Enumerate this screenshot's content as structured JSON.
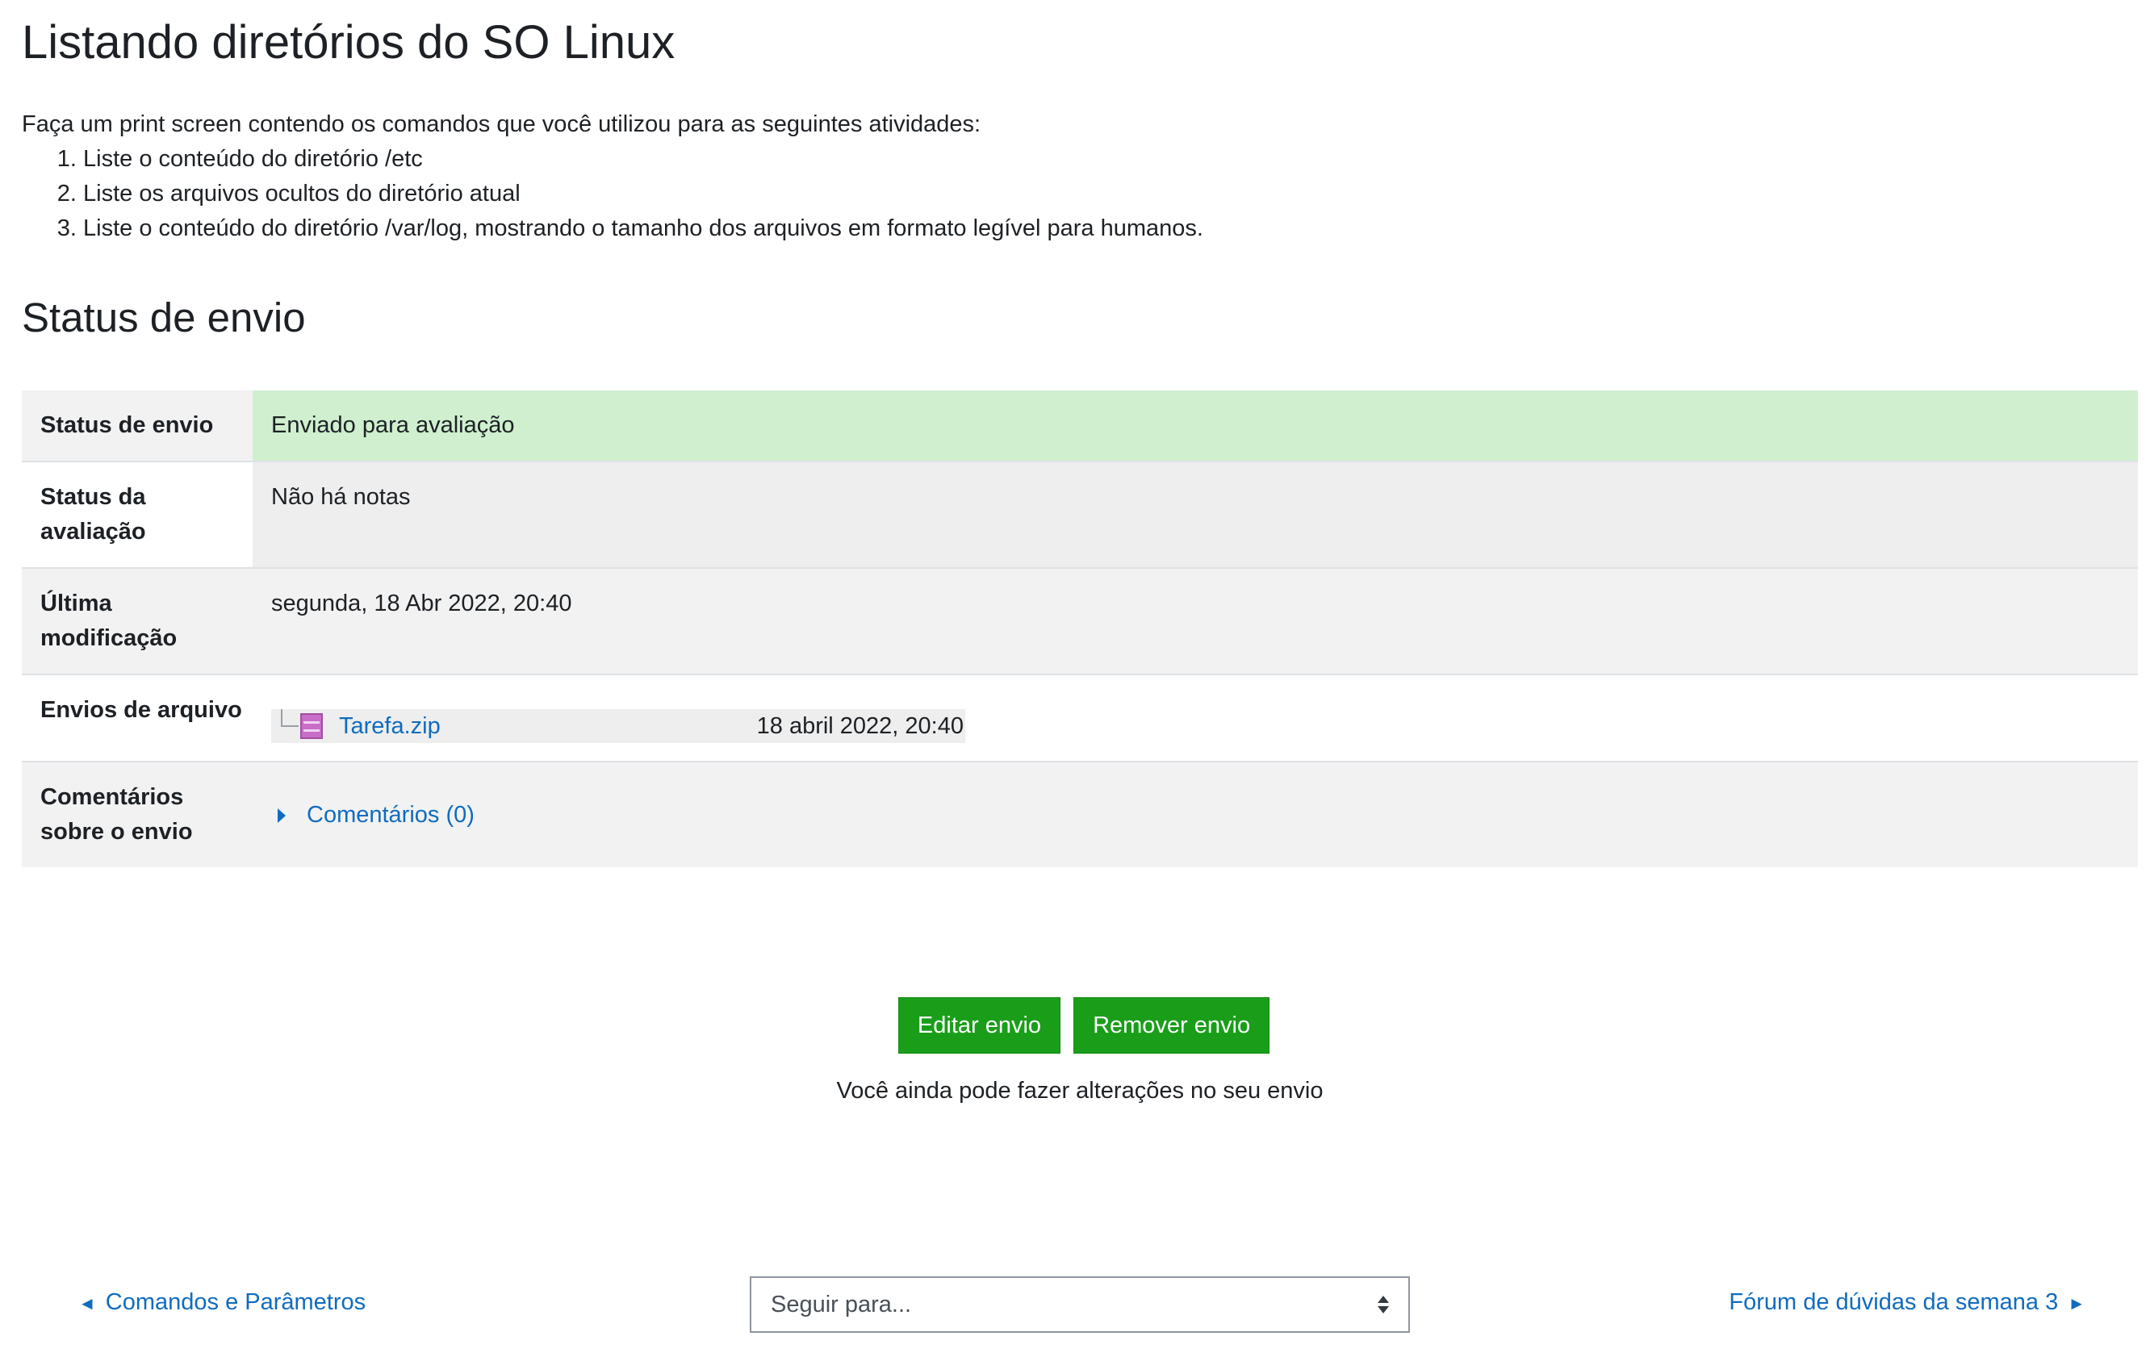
{
  "page": {
    "title": "Listando diretórios do SO Linux"
  },
  "intro": {
    "lead": "Faça um print screen contendo os comandos que você utilizou para as seguintes atividades:",
    "items": [
      "Liste o conteúdo do diretório /etc",
      "Liste os arquivos ocultos do diretório atual",
      "Liste o conteúdo do diretório /var/log, mostrando o tamanho dos arquivos em formato legível para humanos."
    ]
  },
  "status_section": {
    "title": "Status de envio",
    "rows": {
      "submission_status": {
        "label": "Status de envio",
        "value": "Enviado para avaliação"
      },
      "grading_status": {
        "label": "Status da avaliação",
        "value": "Não há notas"
      },
      "last_modified": {
        "label": "Última modificação",
        "value": "segunda, 18 Abr 2022, 20:40"
      },
      "file_submissions": {
        "label": "Envios de arquivo",
        "file_name": "Tarefa.zip",
        "file_date": "18 abril 2022, 20:40",
        "file_icon": "zip-archive-icon"
      },
      "submission_comments": {
        "label": "Comentários sobre o envio",
        "link": "Comentários (0)"
      }
    }
  },
  "actions": {
    "edit_label": "Editar envio",
    "remove_label": "Remover envio",
    "helper": "Você ainda pode fazer alterações no seu envio"
  },
  "nav": {
    "prev_label": "Comandos e Parâmetros",
    "next_label": "Fórum de dúvidas da semana 3",
    "jump_placeholder": "Seguir para..."
  },
  "colors": {
    "link": "#0f6cbf",
    "button": "#1a9e1a",
    "submitted_bg": "#cfefcf"
  }
}
